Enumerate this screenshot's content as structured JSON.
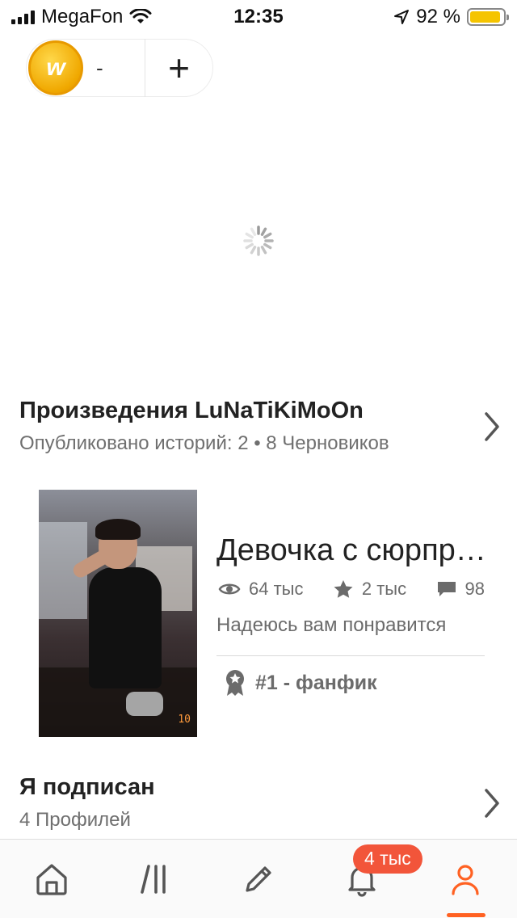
{
  "status_bar": {
    "carrier": "MegaFon",
    "time": "12:35",
    "battery_text": "92 %",
    "battery_level": 0.92
  },
  "coins": {
    "coin_letter": "w",
    "count": "-",
    "add_label": "+"
  },
  "works": {
    "title": "Произведения LuNaTiKiMoOn",
    "subtitle": "Опубликовано историй: 2 • 8 Черновиков"
  },
  "story": {
    "title": "Девочка с сюрпризом",
    "views": "64 тыс",
    "votes": "2 тыс",
    "comments": "98",
    "description": "Надеюсь вам понравится",
    "rank": "#1 - фанфик",
    "cover_stamp": "10"
  },
  "following": {
    "title": "Я подписан",
    "subtitle": "4 Профилей"
  },
  "bottom_nav": {
    "items": [
      {
        "icon": "home-icon"
      },
      {
        "icon": "library-icon"
      },
      {
        "icon": "pencil-icon"
      },
      {
        "icon": "bell-icon",
        "badge": "4 тыс"
      },
      {
        "icon": "profile-icon",
        "active": true
      }
    ],
    "accent_color": "#ff6122",
    "badge_color": "#f2553a"
  },
  "colors": {
    "coin": "#f5b400",
    "text_primary": "#222222",
    "text_secondary": "#6b6b6b"
  }
}
